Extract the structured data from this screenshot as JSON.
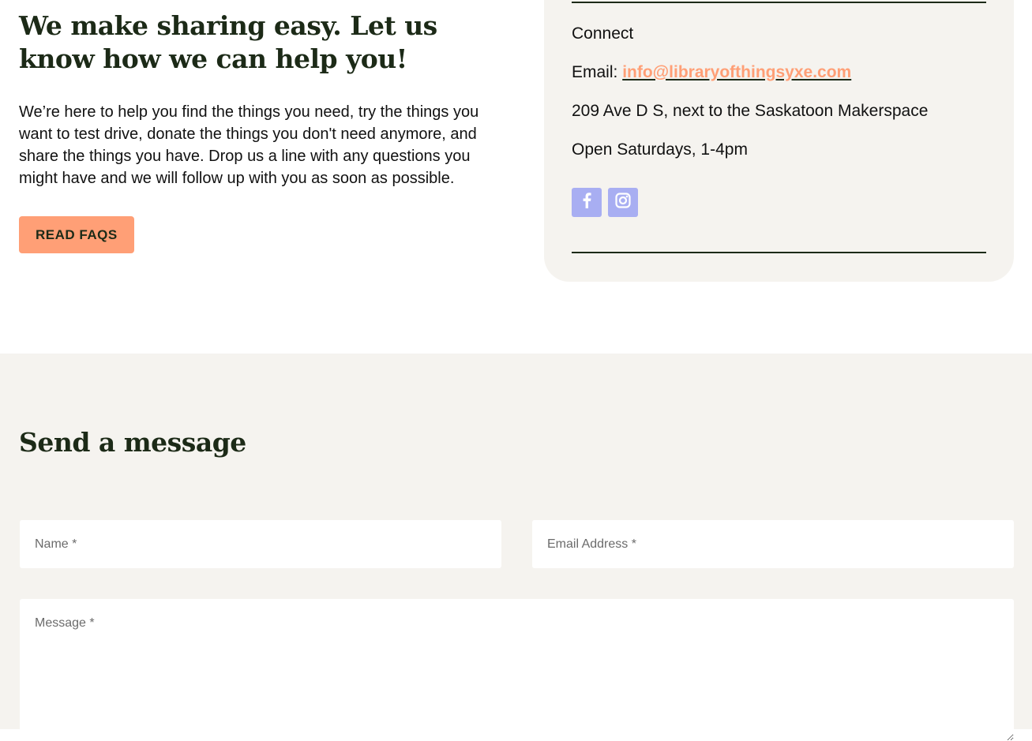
{
  "intro": {
    "title": "We make sharing easy. Let us know how we can help you!",
    "body": "We’re here to help you find the things you need, try the things you want to test drive, donate the things you don't need anymore, and share the things you have. Drop us a line with any questions you might have and we will follow up with you as soon as possible.",
    "faq_button_label": "READ FAQS"
  },
  "connect": {
    "heading": "Connect",
    "email_prefix": "Email: ",
    "email": "info@libraryofthingsyxe.com",
    "address": "209 Ave D S, next to the Saskatoon Makerspace",
    "hours": "Open Saturdays, 1-4pm",
    "social_icons": [
      "facebook-icon",
      "instagram-icon"
    ]
  },
  "form": {
    "title": "Send a message",
    "name_placeholder": "Name *",
    "email_placeholder": "Email Address *",
    "message_placeholder": "Message *"
  },
  "colors": {
    "accent": "#ff9f76",
    "social": "#a8aef2",
    "text_dark": "#1c2a17",
    "panel_bg": "#f5f3ef"
  }
}
